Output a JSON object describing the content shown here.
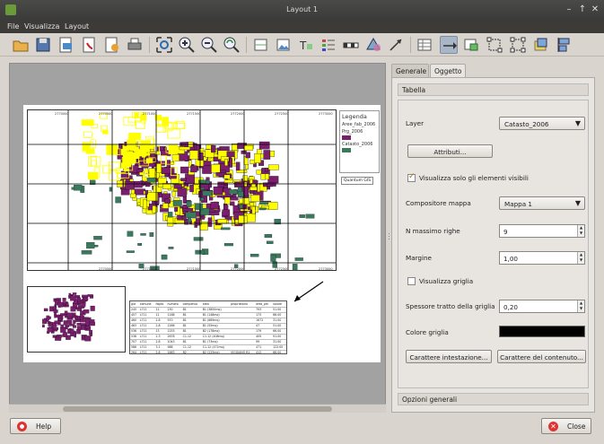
{
  "window": {
    "title": "Layout 1",
    "minimize": "–",
    "maximize": "↑",
    "close": "✕"
  },
  "menu": {
    "items": [
      "File",
      "Visualizza",
      "Layout"
    ]
  },
  "colors": {
    "purple": "#7a1f6d",
    "yellow": "#ffff00",
    "green": "#3a7a5a",
    "accent": "#b36a10"
  },
  "layout": {
    "legend": {
      "title": "Legenda",
      "items": [
        {
          "label": "Aree_fab_2006",
          "color": "#ffffff"
        },
        {
          "label": "Prg_2006",
          "color": "#7a1f6d"
        },
        {
          "label": "Catasto_2006",
          "color": "#3a7a5a"
        }
      ]
    },
    "label_item": "Quantum GIS",
    "grid_top": [
      "2770000",
      "2770500",
      "2771000",
      "2771500",
      "2772000",
      "2772500",
      "2773000"
    ],
    "grid_side": [
      "4888000",
      "4887500",
      "4887000",
      "4886500"
    ],
    "table": {
      "headers": [
        "gid",
        "comune",
        "foglio",
        "numero",
        "compenso",
        "area",
        "proprietario",
        "area_pm",
        "valore"
      ],
      "rows": [
        [
          "245",
          "L711",
          "11",
          "230",
          "B1",
          "B1 (3800mq)",
          "",
          "793",
          "51.00"
        ],
        [
          "457",
          "L711",
          "11",
          "1168",
          "B1",
          "B1 (148mq)",
          "",
          "173",
          "66.00"
        ],
        [
          "460",
          "L711",
          "2.8",
          "970",
          "B1",
          "B1 (689mq)",
          "",
          "1672",
          "31.00"
        ],
        [
          "463",
          "L711",
          "2.8",
          "1266",
          "B1",
          "B1 (55mq)",
          "",
          "47",
          "51.00"
        ],
        [
          "536",
          "L711",
          "13",
          "1253",
          "B1",
          "B2 (178mq)",
          "",
          "179",
          "66.00"
        ],
        [
          "538",
          "L711",
          "2.3",
          "2678",
          "C1-12",
          "C1-12 (408mq)",
          "",
          "409",
          "91.00"
        ],
        [
          "707",
          "L711",
          "2.8",
          "1043",
          "B1",
          "B1 (73mq)",
          "",
          "99",
          "31.00"
        ],
        [
          "586",
          "L711",
          "3.1",
          "988",
          "C1-12",
          "C1-12 (471mq)",
          "",
          "471",
          "122.00"
        ],
        [
          "264",
          "L711",
          "2.8",
          "1663",
          "B2",
          "B2 (225mq)",
          "VIGGIANO B1",
          "412",
          "66.00"
        ]
      ]
    }
  },
  "tabs": [
    {
      "label": "Generale",
      "selected": false
    },
    {
      "label": "Oggetto",
      "selected": true
    }
  ],
  "panel": {
    "section_title": "Tabella",
    "layer_label": "Layer",
    "layer_value": "Catasto_2006",
    "attributes_button": "Attributi...",
    "visible_only_label": "Visualizza solo gli elementi visibili",
    "visible_only_checked": true,
    "composer_map_label": "Compositore mappa",
    "composer_map_value": "Mappa 1",
    "max_rows_label": "N massimo righe",
    "max_rows_value": "9",
    "margin_label": "Margine",
    "margin_value": "1,00",
    "show_grid_label": "Visualizza griglia",
    "show_grid_checked": false,
    "grid_stroke_label": "Spessore tratto della griglia",
    "grid_stroke_value": "0,20",
    "grid_color_label": "Colore griglia",
    "grid_color": "#000000",
    "header_font_button": "Carattere intestazione...",
    "content_font_button": "Carattere del contenuto...",
    "general_options": "Opzioni generali"
  },
  "footer": {
    "help": "Help",
    "close": "Close"
  }
}
